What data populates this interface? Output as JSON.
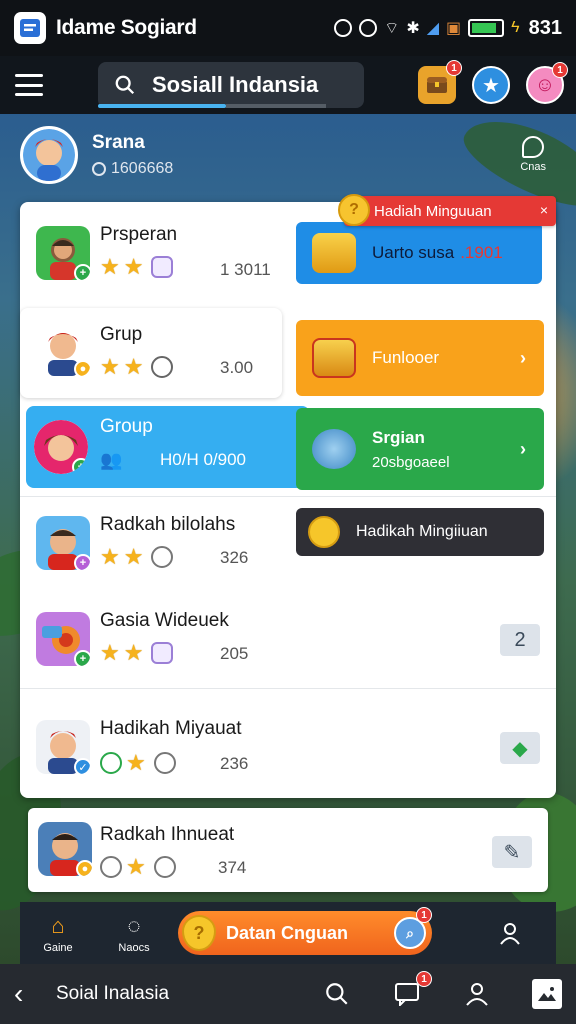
{
  "status_bar": {
    "app_title": "Idame Sogiard",
    "time": "831",
    "colors": {
      "battery": "#35c553"
    }
  },
  "top_bar": {
    "search_value": "Sosiall Indansia",
    "actions": [
      {
        "icon": "treasure-chest-icon",
        "badge": "1"
      },
      {
        "icon": "star-icon",
        "badge": ""
      },
      {
        "icon": "smiley-icon",
        "badge": "1"
      }
    ]
  },
  "profile": {
    "name": "Srana",
    "id": "1606668",
    "corner_label": "Cnas"
  },
  "rows": [
    {
      "title": "Prsperan",
      "value": "1 3011",
      "tile_label": "Uarto susa",
      "tile_value": ".1901",
      "tile_color": "#1f8de6"
    },
    {
      "title": "Grup",
      "value": "3.00",
      "tile_label": "Funlooer",
      "tile_color": "#f9a21b"
    },
    {
      "title": "Group",
      "value": "H0/H 0/900",
      "tile_label": "Srgian",
      "tile_sub": "20sbgoaeel",
      "tile_color": "#2aa84a"
    },
    {
      "title": "Radkah bilolahs",
      "value": "326",
      "tile_label": "Hadikah Mingiiuan",
      "tile_color": "#2f2f35"
    },
    {
      "title": "Gasia Wideuek",
      "value": "205",
      "side_chip": "2"
    },
    {
      "title": "Hadikah Miyauat",
      "value": "236",
      "side_chip": "leaf"
    }
  ],
  "ribbon": {
    "label": "Hadiah Minguuan",
    "close": "×",
    "coin": "?"
  },
  "bottom_card": {
    "title": "Radkah Ihnueat",
    "value": "374"
  },
  "tabbar": {
    "home_label": "Gaine",
    "notice_label": "Naocs",
    "cta_label": "Datan Cnguan",
    "cta_badge": "1"
  },
  "navbar": {
    "back_label": "Soial Inalasia",
    "message_badge": "1"
  },
  "colors": {
    "accent_blue": "#35aef1",
    "orange": "#f9a21b",
    "green": "#2aa84a",
    "red": "#e53935",
    "gold": "#f6b21d"
  }
}
